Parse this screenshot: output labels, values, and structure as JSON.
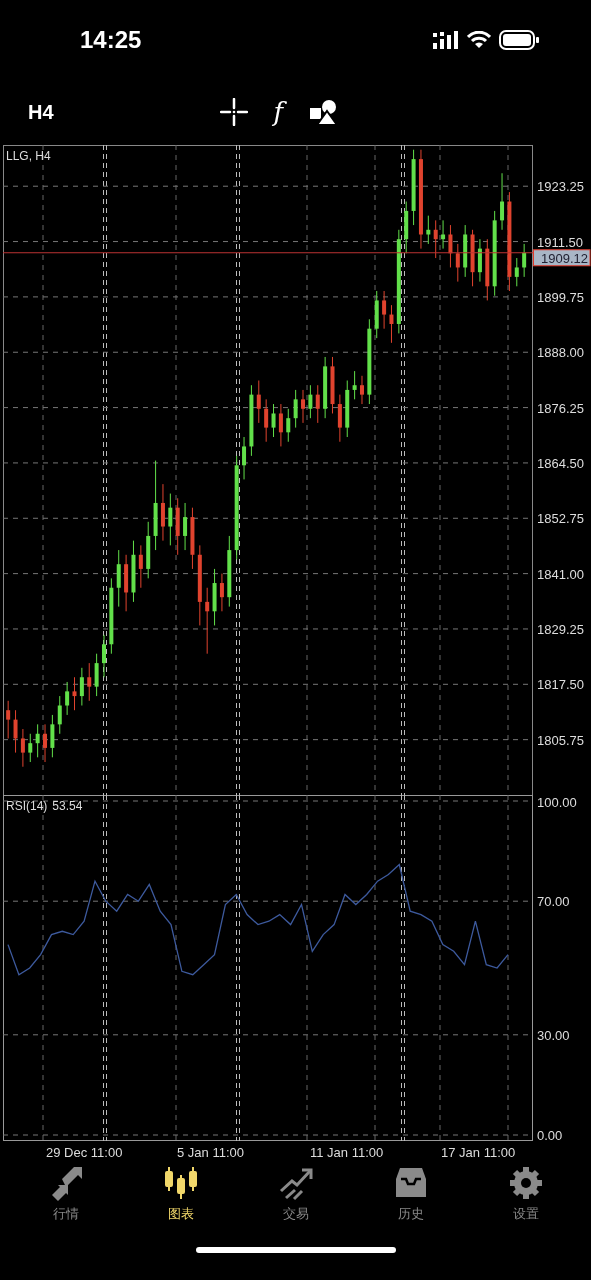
{
  "status_bar": {
    "time": "14:25"
  },
  "toolbar": {
    "timeframe": "H4",
    "function_button": "f"
  },
  "main_chart": {
    "chart_data": {
      "type": "candlestick",
      "title": "LLG, H4",
      "ref_lines": [
        {
          "axis": "y",
          "value": 1909.12,
          "label": "1909.12",
          "color": "#bb3333"
        }
      ],
      "ylim": [
        1794,
        1932
      ],
      "yticks": [
        {
          "value": 1923.25,
          "label": "1923.25"
        },
        {
          "value": 1911.5,
          "label": "1911.50"
        },
        {
          "value": 1899.75,
          "label": "1899.75"
        },
        {
          "value": 1888,
          "label": "1888.00"
        },
        {
          "value": 1876.25,
          "label": "1876.25"
        },
        {
          "value": 1864.5,
          "label": "1864.50"
        },
        {
          "value": 1852.75,
          "label": "1852.75"
        },
        {
          "value": 1841,
          "label": "1841.00"
        },
        {
          "value": 1829.25,
          "label": "1829.25"
        },
        {
          "value": 1817.5,
          "label": "1817.50"
        },
        {
          "value": 1805.75,
          "label": "1805.75"
        }
      ],
      "grid": true,
      "categories": [
        null,
        null,
        null,
        null,
        null,
        null,
        null,
        null,
        null,
        null,
        null,
        null,
        null,
        null,
        null,
        null,
        null,
        null,
        null,
        null,
        null,
        null,
        null,
        null,
        null,
        null,
        null,
        null,
        null,
        null,
        null,
        null,
        null,
        null,
        null,
        null,
        null,
        null,
        null,
        null,
        null,
        null,
        null,
        null,
        null,
        null,
        null,
        null,
        null,
        null,
        null,
        null,
        null,
        null,
        null,
        null,
        null,
        null,
        null,
        null,
        null,
        null,
        null,
        null,
        null,
        null,
        null,
        null,
        null,
        null,
        null
      ],
      "ohlc": [
        [
          1812,
          1814,
          1806,
          1810
        ],
        [
          1810,
          1812,
          1803,
          1806
        ],
        [
          1806,
          1808,
          1800,
          1803
        ],
        [
          1803,
          1807,
          1801,
          1805
        ],
        [
          1805,
          1809,
          1802,
          1807
        ],
        [
          1807,
          1809,
          1801,
          1804
        ],
        [
          1804,
          1811,
          1802,
          1809
        ],
        [
          1809,
          1815,
          1807,
          1813
        ],
        [
          1813,
          1818,
          1811,
          1816
        ],
        [
          1816,
          1819,
          1812,
          1815
        ],
        [
          1815,
          1821,
          1813,
          1819
        ],
        [
          1819,
          1822,
          1814,
          1817
        ],
        [
          1817,
          1824,
          1815,
          1822
        ],
        [
          1822,
          1828,
          1819,
          1826
        ],
        [
          1826,
          1840,
          1824,
          1838
        ],
        [
          1838,
          1846,
          1834,
          1843
        ],
        [
          1843,
          1845,
          1833,
          1837
        ],
        [
          1837,
          1848,
          1835,
          1845
        ],
        [
          1845,
          1847,
          1838,
          1842
        ],
        [
          1842,
          1852,
          1840,
          1849
        ],
        [
          1849,
          1865,
          1846,
          1856
        ],
        [
          1856,
          1860,
          1848,
          1851
        ],
        [
          1851,
          1858,
          1847,
          1855
        ],
        [
          1855,
          1857,
          1845,
          1849
        ],
        [
          1849,
          1856,
          1846,
          1853
        ],
        [
          1853,
          1855,
          1842,
          1845
        ],
        [
          1845,
          1847,
          1830,
          1835
        ],
        [
          1835,
          1838,
          1824,
          1833
        ],
        [
          1833,
          1842,
          1830,
          1839
        ],
        [
          1839,
          1841,
          1833,
          1836
        ],
        [
          1836,
          1849,
          1834,
          1846
        ],
        [
          1846,
          1866,
          1844,
          1864
        ],
        [
          1864,
          1870,
          1861,
          1868
        ],
        [
          1868,
          1881,
          1866,
          1879
        ],
        [
          1879,
          1882,
          1873,
          1876
        ],
        [
          1876,
          1878,
          1869,
          1872
        ],
        [
          1872,
          1877,
          1870,
          1875
        ],
        [
          1875,
          1877,
          1868,
          1871
        ],
        [
          1871,
          1876,
          1869,
          1874
        ],
        [
          1874,
          1880,
          1872,
          1878
        ],
        [
          1878,
          1880,
          1873,
          1876
        ],
        [
          1876,
          1881,
          1874,
          1879
        ],
        [
          1879,
          1881,
          1873,
          1876
        ],
        [
          1876,
          1887,
          1874,
          1885
        ],
        [
          1885,
          1887,
          1875,
          1877
        ],
        [
          1877,
          1879,
          1869,
          1872
        ],
        [
          1872,
          1882,
          1870,
          1880
        ],
        [
          1880,
          1884,
          1878,
          1881
        ],
        [
          1881,
          1883,
          1877,
          1879
        ],
        [
          1879,
          1895,
          1877,
          1893
        ],
        [
          1893,
          1901,
          1891,
          1899
        ],
        [
          1899,
          1901,
          1893,
          1896
        ],
        [
          1896,
          1898,
          1890,
          1894
        ],
        [
          1894,
          1914,
          1892,
          1912
        ],
        [
          1912,
          1920,
          1909,
          1918
        ],
        [
          1918,
          1931,
          1915,
          1929
        ],
        [
          1929,
          1931,
          1910,
          1913
        ],
        [
          1913,
          1917,
          1911,
          1914
        ],
        [
          1914,
          1916,
          1908,
          1912
        ],
        [
          1912,
          1916,
          1910,
          1913
        ],
        [
          1913,
          1915,
          1906,
          1909
        ],
        [
          1909,
          1911,
          1903,
          1906
        ],
        [
          1906,
          1915,
          1904,
          1913
        ],
        [
          1913,
          1914,
          1902,
          1905
        ],
        [
          1905,
          1912,
          1903,
          1910
        ],
        [
          1910,
          1912,
          1899,
          1902
        ],
        [
          1902,
          1918,
          1900,
          1916
        ],
        [
          1916,
          1926,
          1914,
          1920
        ],
        [
          1920,
          1922,
          1901,
          1904
        ],
        [
          1904,
          1908,
          1902,
          1906
        ],
        [
          1906,
          1911,
          1904,
          1909.12
        ]
      ]
    }
  },
  "rsi_panel": {
    "reading": "53.54",
    "chart_data": {
      "type": "line",
      "ylim": [
        0,
        100
      ],
      "yticks": [
        {
          "value": 100,
          "label": "100.00"
        },
        {
          "value": 70,
          "label": "70.00"
        },
        {
          "value": 30,
          "label": "30.00"
        },
        {
          "value": 0,
          "label": "0.00"
        }
      ],
      "grid": true,
      "series": [
        {
          "name": "RSI(14)",
          "color": "#3d5a9e",
          "values": [
            57,
            48,
            50,
            54,
            60,
            61,
            60,
            64,
            76,
            70,
            67,
            72,
            70,
            75,
            67,
            63,
            49,
            48,
            51,
            54,
            69,
            72,
            66,
            63,
            64,
            66,
            63,
            69,
            55,
            60,
            63,
            72,
            69,
            72,
            76,
            78,
            81,
            67,
            66,
            64,
            57,
            55,
            51,
            64,
            51,
            50,
            54
          ]
        }
      ]
    }
  },
  "time_axis": [
    "29 Dec 11:00",
    "5 Jan 11:00",
    "11 Jan 11:00",
    "17 Jan 11:00"
  ],
  "tab_bar": [
    {
      "label": "行情",
      "kind": "quotes",
      "selected": false
    },
    {
      "label": "图表",
      "kind": "chart",
      "selected": true
    },
    {
      "label": "交易",
      "kind": "trade",
      "selected": false
    },
    {
      "label": "历史",
      "kind": "history",
      "selected": false
    },
    {
      "label": "设置",
      "kind": "settings",
      "selected": false
    }
  ]
}
